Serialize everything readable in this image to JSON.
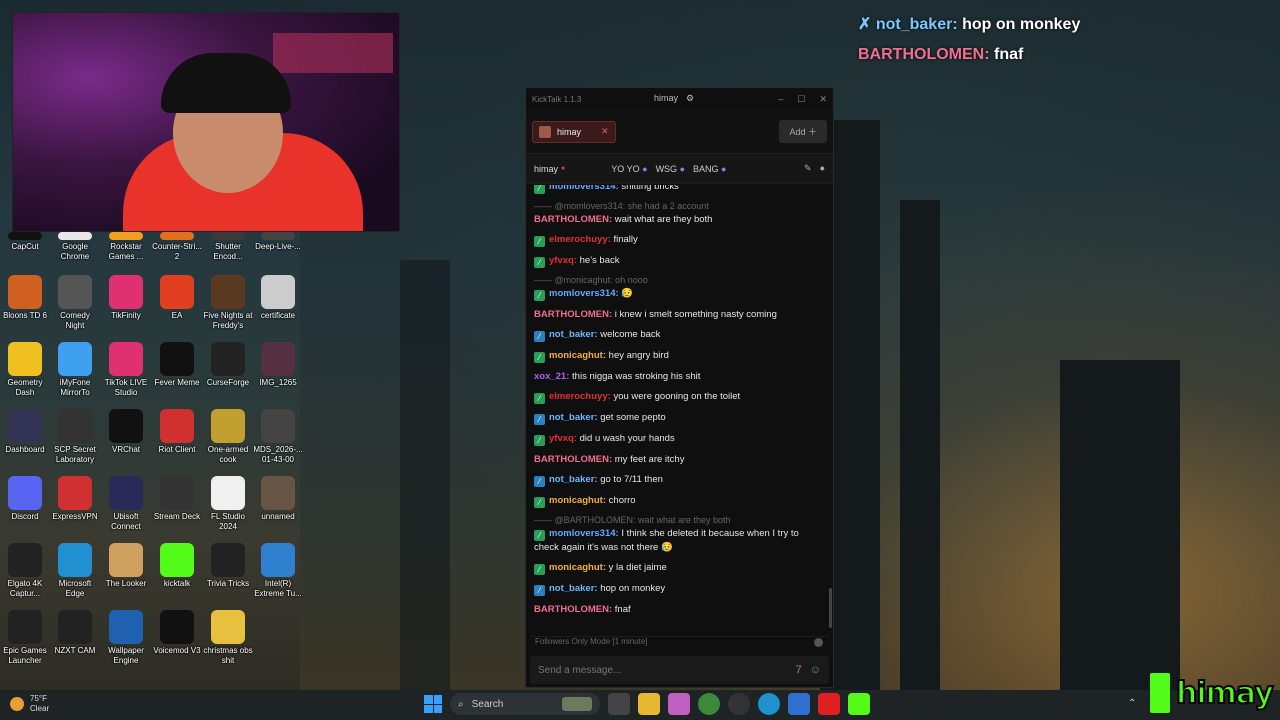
{
  "overlay": {
    "lines": [
      {
        "user": "not_baker",
        "text": "hop on monkey",
        "color": "#7ec8ff",
        "badge": "sword-icon"
      },
      {
        "user": "BARTHOLOMEN",
        "text": "fnaf",
        "color": "#f07090"
      }
    ]
  },
  "desktop_icons": [
    {
      "label": "CapCut",
      "color": "#111"
    },
    {
      "label": "Google Chrome",
      "color": "#e8e8e8"
    },
    {
      "label": "Rockstar Games ...",
      "color": "#f0a020"
    },
    {
      "label": "Counter-Stri... 2",
      "color": "#e07020"
    },
    {
      "label": "Shutter Encod...",
      "color": "#3a3a3a"
    },
    {
      "label": "Deep-Live-...",
      "color": "#444"
    },
    {
      "label": "Bloons TD 6",
      "color": "#d06020"
    },
    {
      "label": "Comedy Night",
      "color": "#555"
    },
    {
      "label": "TikFinity",
      "color": "#e03070"
    },
    {
      "label": "EA",
      "color": "#e04020"
    },
    {
      "label": "Five Nights at Freddy's",
      "color": "#5a3a20"
    },
    {
      "label": "certificate",
      "color": "#ccc"
    },
    {
      "label": "Geometry Dash",
      "color": "#f0c020"
    },
    {
      "label": "iMyFone MirrorTo",
      "color": "#40a0f0"
    },
    {
      "label": "TikTok LIVE Studio",
      "color": "#e03070"
    },
    {
      "label": "Fever Meme",
      "color": "#111"
    },
    {
      "label": "CurseForge",
      "color": "#222"
    },
    {
      "label": "IMG_1265",
      "color": "#553040"
    },
    {
      "label": "Dashboard",
      "color": "#335"
    },
    {
      "label": "SCP Secret Laboratory",
      "color": "#333"
    },
    {
      "label": "VRChat",
      "color": "#111"
    },
    {
      "label": "Riot Client",
      "color": "#d03030"
    },
    {
      "label": "One-armed cook",
      "color": "#c0a030"
    },
    {
      "label": "MDS_2026-... 01-43-00",
      "color": "#444"
    },
    {
      "label": "Discord",
      "color": "#5865f2"
    },
    {
      "label": "ExpressVPN",
      "color": "#d03030"
    },
    {
      "label": "Ubisoft Connect",
      "color": "#2a2a5a"
    },
    {
      "label": "Stream Deck",
      "color": "#333"
    },
    {
      "label": "FL Studio 2024",
      "color": "#f0f0f0"
    },
    {
      "label": "unnamed",
      "color": "#665544"
    },
    {
      "label": "Elgato 4K Captur...",
      "color": "#222"
    },
    {
      "label": "Microsoft Edge",
      "color": "#2090d0"
    },
    {
      "label": "The Looker",
      "color": "#d0a060"
    },
    {
      "label": "kicktalk",
      "color": "#53fc18"
    },
    {
      "label": "Trivia Tricks",
      "color": "#222"
    },
    {
      "label": "Intel(R) Extreme Tu...",
      "color": "#3080d0"
    },
    {
      "label": "Epic Games Launcher",
      "color": "#222"
    },
    {
      "label": "NZXT CAM",
      "color": "#222"
    },
    {
      "label": "Wallpaper Engine",
      "color": "#2060b0"
    },
    {
      "label": "Voicemod V3",
      "color": "#111"
    },
    {
      "label": "christmas obs shit",
      "color": "#e8c040"
    }
  ],
  "kicktalk": {
    "app_title": "KickTalk 1.1.3",
    "channel_name": "himay",
    "tab_label": "himay",
    "add_label": "Add",
    "channel_bar": {
      "name": "himay",
      "emotes": [
        "YO YO",
        "WSG",
        "BANG"
      ]
    },
    "messages": [
      {
        "reply": "",
        "user": "momlovers314",
        "text": "shitting bricks",
        "color": "#6aa8ff",
        "badge": "#2a9d5a"
      },
      {
        "reply": "@momlovers314: she had a 2 account",
        "user": "BARTHOLOMEN",
        "text": "wait what are they both",
        "color": "#f07090",
        "badge": ""
      },
      {
        "reply": "",
        "user": "elmerochuyy",
        "text": "finally",
        "color": "#e03030",
        "badge": "#2a9d5a"
      },
      {
        "reply": "",
        "user": "yfvxq",
        "text": "he's back",
        "color": "#e03030",
        "badge": "#2a9d5a"
      },
      {
        "reply": "@monicaghut: oh nooo",
        "user": "momlovers314",
        "text": "😥",
        "color": "#6aa8ff",
        "badge": "#2a9d5a"
      },
      {
        "reply": "",
        "user": "BARTHOLOMEN",
        "text": "i knew i smelt something nasty coming",
        "color": "#f07090",
        "badge": ""
      },
      {
        "reply": "",
        "user": "not_baker",
        "text": "welcome back",
        "color": "#6ab8ff",
        "badge": "#2a80c0"
      },
      {
        "reply": "",
        "user": "monicaghut",
        "text": "hey angry bird",
        "color": "#f0b040",
        "badge": "#2a9d5a"
      },
      {
        "reply": "",
        "user": "xox_21",
        "text": "this nigga was stroking his shit",
        "color": "#b060f0",
        "badge": ""
      },
      {
        "reply": "",
        "user": "elmerochuyy",
        "text": "you were gooning on the toilet",
        "color": "#e03030",
        "badge": "#2a9d5a"
      },
      {
        "reply": "",
        "user": "not_baker",
        "text": "get some pepto",
        "color": "#6ab8ff",
        "badge": "#2a80c0"
      },
      {
        "reply": "",
        "user": "yfvxq",
        "text": "did u wash your hands",
        "color": "#e03030",
        "badge": "#2a9d5a"
      },
      {
        "reply": "",
        "user": "BARTHOLOMEN",
        "text": "my feet are itchy",
        "color": "#f07090",
        "badge": ""
      },
      {
        "reply": "",
        "user": "not_baker",
        "text": "go to 7/11 then",
        "color": "#6ab8ff",
        "badge": "#2a80c0"
      },
      {
        "reply": "",
        "user": "monicaghut",
        "text": "chorro",
        "color": "#f0b040",
        "badge": "#2a9d5a"
      },
      {
        "reply": "@BARTHOLOMEN: wait what are they both",
        "user": "momlovers314",
        "text": "I think she deleted it because when I try to check again it's was not there 😥",
        "color": "#6aa8ff",
        "badge": "#2a9d5a"
      },
      {
        "reply": "",
        "user": "monicaghut",
        "text": "y la diet jaime",
        "color": "#f0b040",
        "badge": "#2a9d5a"
      },
      {
        "reply": "",
        "user": "not_baker",
        "text": "hop on monkey",
        "color": "#6ab8ff",
        "badge": "#2a80c0"
      },
      {
        "reply": "",
        "user": "BARTHOLOMEN",
        "text": "fnaf",
        "color": "#f07090",
        "badge": ""
      }
    ],
    "mode_text": "Followers Only Mode [1 minute]",
    "input_placeholder": "Send a message..."
  },
  "taskbar": {
    "weather_temp": "75°F",
    "weather_desc": "Clear",
    "search_label": "Search"
  },
  "watermark": "himay"
}
